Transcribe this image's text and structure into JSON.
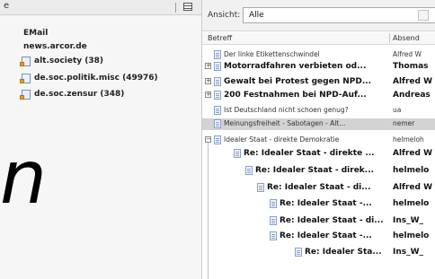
{
  "left_pane": {
    "header_label": "e",
    "accounts": [
      {
        "label": "EMail"
      },
      {
        "label": "news.arcor.de"
      }
    ],
    "groups": [
      {
        "label": "alt.society (38)"
      },
      {
        "label": "de.soc.politik.misc (49976)"
      },
      {
        "label": "de.soc.zensur (348)"
      }
    ],
    "overlay_letter": "n"
  },
  "view_bar": {
    "label": "Ansicht:",
    "value": "Alle"
  },
  "columns": {
    "subject": "Betreff",
    "sender": "Absend"
  },
  "messages": [
    {
      "subject": "Der linke Etikettenschwindel",
      "sender": "Alfred W",
      "bold": false,
      "toggle": "",
      "selected": false
    },
    {
      "subject": "Motorradfahren verbieten od...",
      "sender": "Thomas",
      "bold": true,
      "toggle": "+",
      "selected": false
    },
    {
      "subject": "Gewalt bei Protest gegen NPD...",
      "sender": "Alfred W",
      "bold": true,
      "toggle": "+",
      "selected": false
    },
    {
      "subject": "200 Festnahmen bei NPD-Auf...",
      "sender": "Andreas",
      "bold": true,
      "toggle": "+",
      "selected": false
    },
    {
      "subject": "Ist Deutschland nicht schoen genug?",
      "sender": "ua",
      "bold": false,
      "toggle": "",
      "selected": false
    },
    {
      "subject": "Meinungsfreiheit - Sabotagen - Alt...",
      "sender": "nemer",
      "bold": false,
      "toggle": "",
      "selected": true
    },
    {
      "subject": "Idealer Staat - direkte Demokratie",
      "sender": "helmeloh",
      "bold": false,
      "toggle": "−",
      "selected": false
    },
    {
      "subject": "Re: Idealer Staat - direkte ...",
      "sender": "Alfred W",
      "bold": true,
      "toggle": "",
      "selected": false
    },
    {
      "subject": "Re: Idealer Staat - direk...",
      "sender": "helmelo",
      "bold": true,
      "toggle": "",
      "selected": false
    },
    {
      "subject": "Re: Idealer Staat - di...",
      "sender": "Alfred W",
      "bold": true,
      "toggle": "",
      "selected": false
    },
    {
      "subject": "Re: Idealer Staat -...",
      "sender": "helmelo",
      "bold": true,
      "toggle": "",
      "selected": false
    },
    {
      "subject": "Re: Idealer Staat - di...",
      "sender": "Ins_W_",
      "bold": true,
      "toggle": "",
      "selected": false
    },
    {
      "subject": "Re: Idealer Staat -...",
      "sender": "helmelo",
      "bold": true,
      "toggle": "",
      "selected": false
    },
    {
      "subject": "Re: Idealer Sta...",
      "sender": "Ins_W_",
      "bold": true,
      "toggle": "",
      "selected": false
    }
  ]
}
